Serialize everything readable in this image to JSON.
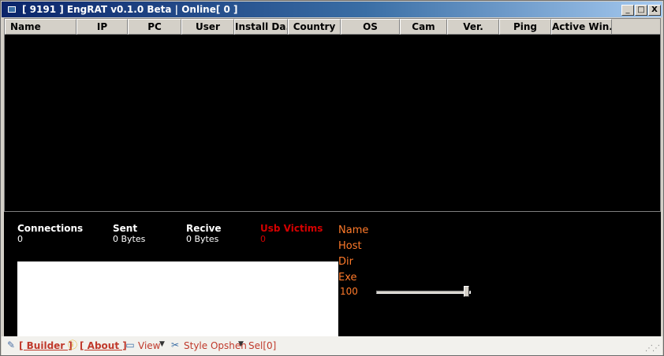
{
  "window": {
    "title": "[ 9191 ] EngRAT v0.1.0 Beta | Online[ 0 ]",
    "controls": {
      "minimize": "_",
      "maximize": "□",
      "close": "X"
    }
  },
  "list": {
    "columns": [
      "Name",
      "IP",
      "PC",
      "User",
      "Install Da...",
      "Country",
      "OS",
      "Cam",
      "Ver.",
      "Ping",
      "Active Win..."
    ],
    "rows": []
  },
  "stats": {
    "connections": {
      "label": "Connections",
      "value": "0"
    },
    "sent": {
      "label": "Sent",
      "value": "0 Bytes"
    },
    "recive": {
      "label": "Recive",
      "value": "0 Bytes"
    },
    "usb": {
      "label": "Usb Victims",
      "value": "0"
    }
  },
  "info": {
    "name": "Name",
    "host": "Host",
    "dir": "Dir",
    "exe": "Exe",
    "slider_value": "100"
  },
  "statusbar": {
    "builder": "[ Builder ]",
    "about": "[ About ]",
    "view": "View",
    "style": "Style Opshen",
    "sel": "Sel[0]"
  },
  "colors": {
    "panel_bg": "#000000",
    "accent_orange": "#ff7a2a",
    "accent_red": "#d40000",
    "title_gradient_start": "#0a246a"
  }
}
